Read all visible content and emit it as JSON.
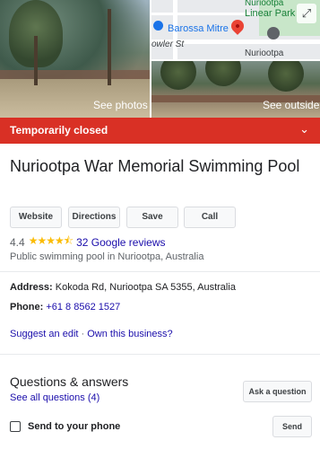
{
  "photos": {
    "see_photos": "See photos",
    "see_outside": "See outside"
  },
  "map": {
    "labels": [
      "Nuriootpa",
      "Linear Park",
      "Barossa Mitre",
      "Nuriootpa",
      "owler St"
    ],
    "expand_icon": "expand-icon"
  },
  "status": {
    "label": "Temporarily closed",
    "color": "#d93025"
  },
  "place": {
    "name": "Nuriootpa War Memorial Swimming Pool",
    "actions": [
      "Website",
      "Directions",
      "Save",
      "Call"
    ],
    "rating": "4.4",
    "reviews_link": "32 Google reviews",
    "category": "Public swimming pool in Nuriootpa, Australia"
  },
  "details": {
    "address_label": "Address:",
    "address": "Kokoda Rd, Nuriootpa SA 5355, Australia",
    "phone_label": "Phone:",
    "phone": "+61 8 8562 1527"
  },
  "links": {
    "suggest_edit": "Suggest an edit",
    "separator": "·",
    "own_business": "Own this business?"
  },
  "qa": {
    "title": "Questions & answers",
    "see_all": "See all questions (4)",
    "ask_button": "Ask a question"
  },
  "send": {
    "label": "Send to your phone",
    "button": "Send"
  }
}
